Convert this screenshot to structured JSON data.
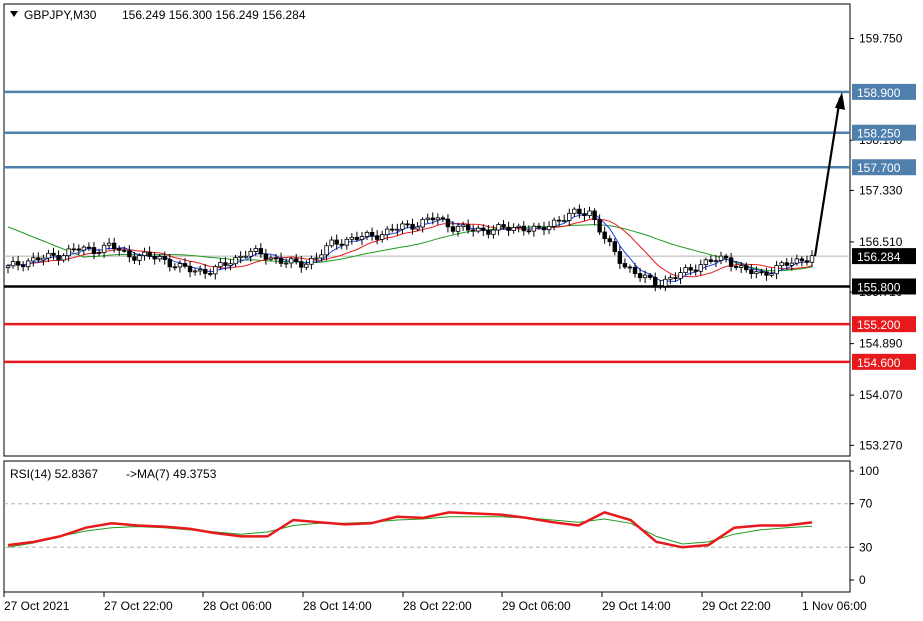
{
  "header": {
    "symbol": "GBPJPY,M30",
    "ohlc": "156.249 156.300 156.249 156.284"
  },
  "rsi_header": {
    "label": "RSI(14) 52.8367",
    "ma_label": "->MA(7) 49.3753"
  },
  "colors": {
    "blue_level": "#4f7fad",
    "red_level": "#e8191c",
    "black_level": "#000000",
    "ma_red": "#e8191c",
    "ma_green": "#1f9b1f",
    "ma_blue": "#1f3fe8",
    "rsi_line": "#e8191c",
    "rsi_ma": "#1f9b1f",
    "price_tag_bg": "#000000"
  },
  "chart_data": [
    {
      "type": "candlestick",
      "symbol": "GBPJPY",
      "timeframe": "M30",
      "ylim": [
        153.1,
        160.3
      ],
      "y_ticks": [
        "159.750",
        "158.130",
        "157.330",
        "156.510",
        "155.710",
        "154.890",
        "154.070",
        "153.270"
      ],
      "x_ticks": [
        "27 Oct 2021",
        "27 Oct 22:00",
        "28 Oct 06:00",
        "28 Oct 14:00",
        "28 Oct 22:00",
        "29 Oct 06:00",
        "29 Oct 14:00",
        "29 Oct 22:00",
        "1 Nov 06:00"
      ],
      "current_price": "156.284",
      "levels": [
        {
          "value": 158.9,
          "label": "158.900",
          "color": "blue"
        },
        {
          "value": 158.25,
          "label": "158.250",
          "color": "blue"
        },
        {
          "value": 157.7,
          "label": "157.700",
          "color": "blue"
        },
        {
          "value": 155.8,
          "label": "155.800",
          "color": "black"
        },
        {
          "value": 155.2,
          "label": "155.200",
          "color": "red"
        },
        {
          "value": 154.6,
          "label": "154.600",
          "color": "red"
        }
      ],
      "close_path": [
        156.1,
        156.2,
        156.25,
        156.3,
        156.4,
        156.38,
        156.45,
        156.3,
        156.28,
        156.25,
        156.1,
        156.05,
        156.05,
        156.2,
        156.35,
        156.3,
        156.2,
        156.15,
        156.25,
        156.5,
        156.55,
        156.6,
        156.65,
        156.75,
        156.8,
        156.9,
        156.75,
        156.7,
        156.7,
        156.72,
        156.75,
        156.68,
        156.85,
        156.95,
        157.0,
        156.5,
        156.15,
        155.95,
        155.85,
        155.95,
        156.1,
        156.2,
        156.25,
        156.05,
        156.0,
        156.1,
        156.2,
        156.28
      ],
      "projection": {
        "from": 156.284,
        "to": 158.9
      }
    },
    {
      "type": "line",
      "name": "RSI(14)",
      "ylim": [
        0,
        100
      ],
      "y_ticks": [
        "100",
        "70",
        "30",
        "0"
      ],
      "levels": [
        70,
        30
      ],
      "rsi": [
        32,
        35,
        40,
        48,
        52,
        50,
        49,
        47,
        43,
        40,
        40,
        55,
        53,
        51,
        52,
        58,
        57,
        62,
        61,
        60,
        57,
        53,
        50,
        62,
        55,
        35,
        30,
        32,
        48,
        50,
        50,
        52.8
      ],
      "rsi_ma": [
        30,
        34,
        40,
        45,
        48,
        49,
        48,
        46,
        44,
        42,
        44,
        50,
        52,
        52,
        53,
        55,
        56,
        58,
        58,
        58,
        57,
        55,
        53,
        56,
        52,
        40,
        33,
        35,
        42,
        46,
        48,
        49.4
      ]
    }
  ]
}
